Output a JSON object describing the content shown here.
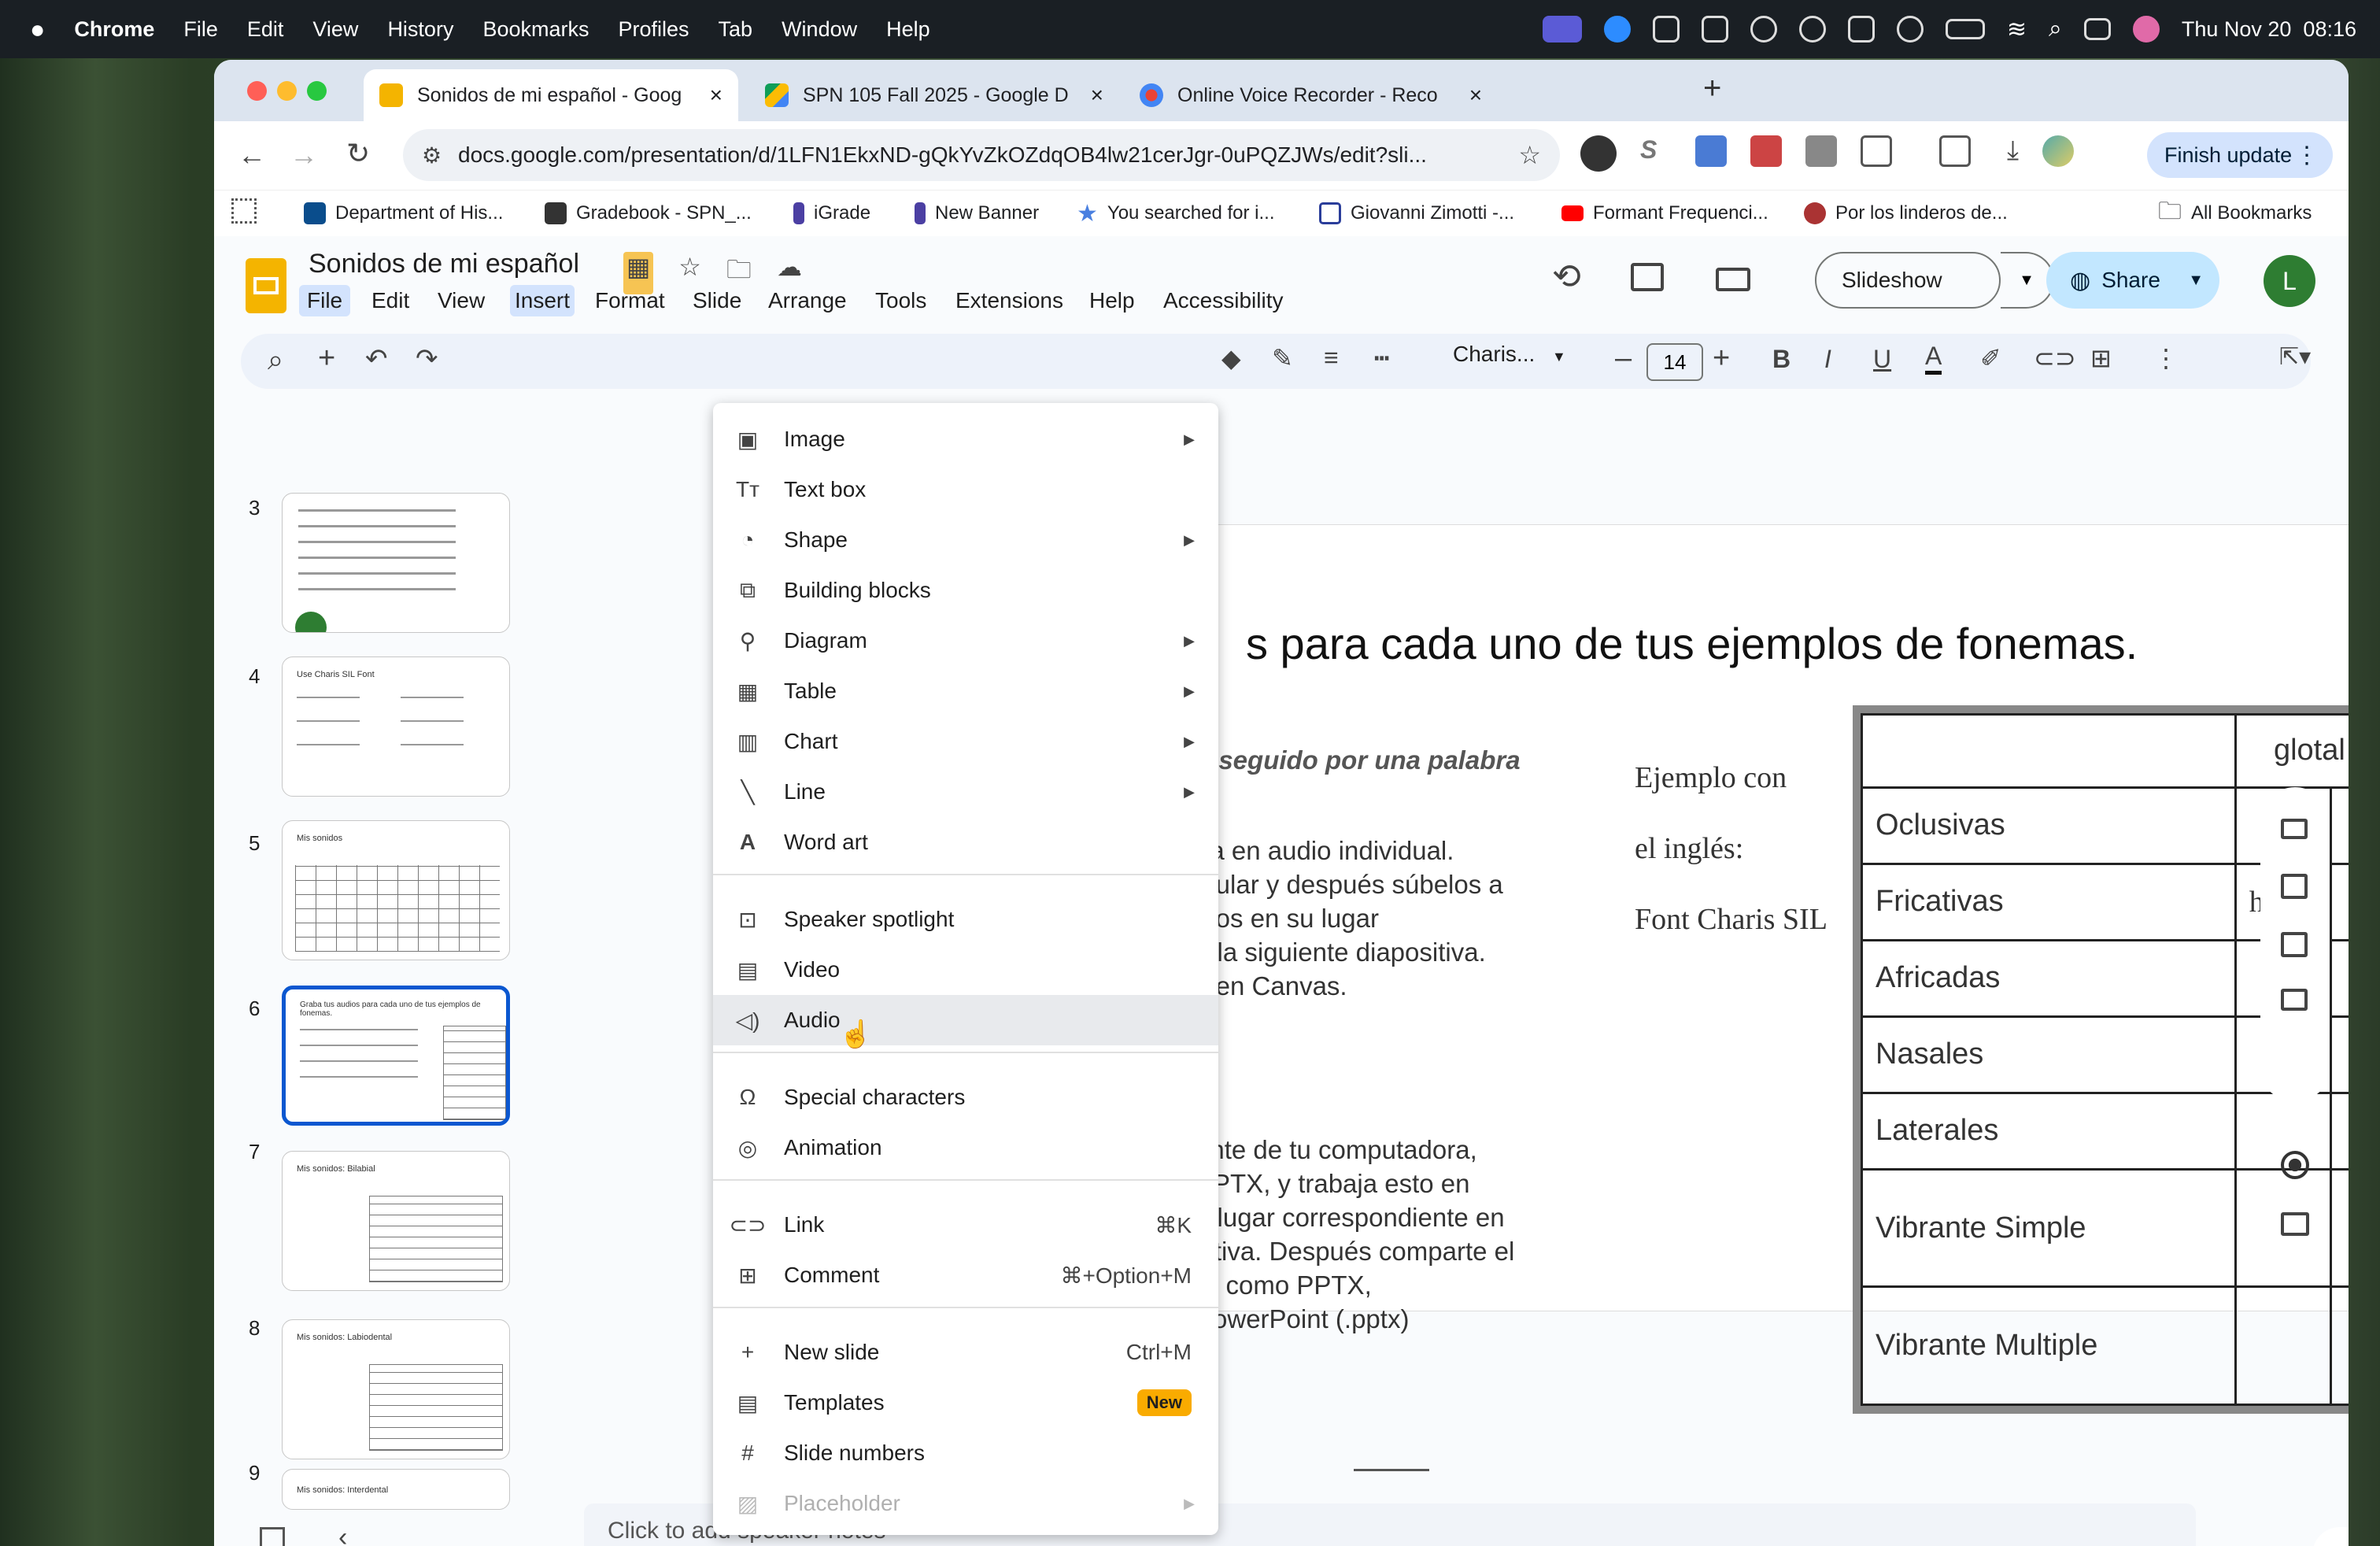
{
  "macbar": {
    "app": "Chrome",
    "menus": [
      "File",
      "Edit",
      "View",
      "History",
      "Bookmarks",
      "Profiles",
      "Tab",
      "Window",
      "Help"
    ],
    "clock": "Thu Nov 20  08:16"
  },
  "tabs": [
    {
      "label": "Sonidos de mi español - Goog",
      "active": true
    },
    {
      "label": "SPN 105 Fall 2025 - Google D",
      "active": false
    },
    {
      "label": "Online Voice Recorder - Reco",
      "active": false
    }
  ],
  "browser": {
    "url": "docs.google.com/presentation/d/1LFN1EkxND-gQkYvZkOZdqOB4lw21cerJgr-0uPQZJWs/edit?sli...",
    "finish_update": "Finish update"
  },
  "bookmarks": [
    "Department of His...",
    "Gradebook - SPN_...",
    "iGrade",
    "New Banner",
    "You searched for i...",
    "Giovanni Zimotti -...",
    "Formant Frequenci...",
    "Por los linderos de..."
  ],
  "all_bookmarks": "All Bookmarks",
  "doc": {
    "title": "Sonidos de mi español",
    "menus": [
      "File",
      "Edit",
      "View",
      "Insert",
      "Format",
      "Slide",
      "Arrange",
      "Tools",
      "Extensions",
      "Help",
      "Accessibility"
    ],
    "slideshow": "Slideshow",
    "share": "Share",
    "avatar": "L"
  },
  "format": {
    "font": "Charis...",
    "size": "14"
  },
  "filmstrip": [
    "3",
    "4",
    "5",
    "6",
    "7",
    "8",
    "9"
  ],
  "thumb_text": {
    "t4": "Use Charis SIL Font",
    "t5": "Mis sonidos",
    "t6": "Graba tus audios para cada uno de tus ejemplos de fonemas.",
    "t7": "Mis sonidos: Bilabial",
    "t8": "Mis sonidos: Labiodental",
    "t9": "Mis sonidos: Interdental"
  },
  "slide": {
    "title": "s para cada uno de tus ejemplos de fonemas.",
    "subtitle": "n seguido por una palabra",
    "para1": [
      "na en audio individual.",
      "elular y después súbelos a",
      "idos en su lugar",
      "n la siguiente diapositiva.",
      "s en Canvas."
    ],
    "para2": [
      "ente de tu computadora,",
      "PPTX, y trabaja esto en",
      "u lugar correspondiente en",
      "sitiva. Después comparte el",
      "ar como PPTX,",
      "PowerPoint (.pptx)"
    ],
    "example": [
      "Ejemplo con",
      "el inglés:",
      "Font Charis SIL"
    ],
    "table": {
      "header": "glotal",
      "rows": [
        "Oclusivas",
        "Fricativas",
        "Africadas",
        "Nasales",
        "Laterales",
        "Vibrante Simple",
        "Vibrante Multiple"
      ],
      "cell_value": "h"
    }
  },
  "notes": "Click to add speaker notes",
  "menu": {
    "items": [
      {
        "label": "Image",
        "icon": "image-icon",
        "arrow": true
      },
      {
        "label": "Text box",
        "icon": "textbox-icon"
      },
      {
        "label": "Shape",
        "icon": "shape-icon",
        "arrow": true
      },
      {
        "label": "Building blocks",
        "icon": "building-blocks-icon"
      },
      {
        "label": "Diagram",
        "icon": "diagram-icon",
        "arrow": true
      },
      {
        "label": "Table",
        "icon": "table-icon",
        "arrow": true
      },
      {
        "label": "Chart",
        "icon": "chart-icon",
        "arrow": true
      },
      {
        "label": "Line",
        "icon": "line-icon",
        "arrow": true
      },
      {
        "label": "Word art",
        "icon": "word-art-icon"
      },
      {
        "label": "Speaker spotlight",
        "icon": "speaker-spotlight-icon"
      },
      {
        "label": "Video",
        "icon": "video-icon"
      },
      {
        "label": "Audio",
        "icon": "audio-icon",
        "highlighted": true
      },
      {
        "label": "Special characters",
        "icon": "omega-icon"
      },
      {
        "label": "Animation",
        "icon": "animation-icon"
      },
      {
        "label": "Link",
        "icon": "link-icon",
        "shortcut": "⌘K"
      },
      {
        "label": "Comment",
        "icon": "comment-icon",
        "shortcut": "⌘+Option+M"
      },
      {
        "label": "New slide",
        "icon": "plus-icon",
        "shortcut": "Ctrl+M"
      },
      {
        "label": "Templates",
        "icon": "templates-icon",
        "badge": "New"
      },
      {
        "label": "Slide numbers",
        "icon": "hash-icon"
      },
      {
        "label": "Placeholder",
        "icon": "placeholder-icon",
        "arrow": true,
        "disabled": true
      }
    ]
  }
}
